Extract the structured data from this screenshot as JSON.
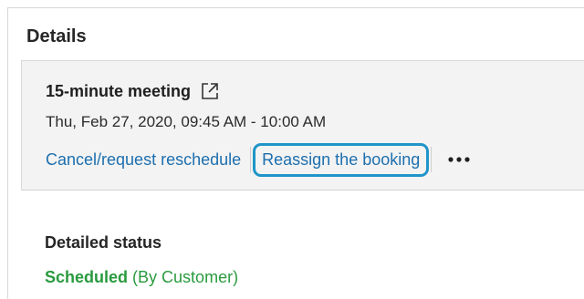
{
  "panel": {
    "title": "Details"
  },
  "booking": {
    "title": "15-minute meeting",
    "time": "Thu, Feb 27, 2020, 09:45 AM - 10:00 AM",
    "actions": {
      "cancel_label": "Cancel/request reschedule",
      "reassign_label": "Reassign the booking",
      "more_icon": "more-horizontal-icon"
    },
    "title_icon": "external-link-icon"
  },
  "status": {
    "label": "Detailed status",
    "value": "Scheduled",
    "by": "(By Customer)"
  },
  "colors": {
    "link": "#1d6fae",
    "focus_ring": "#1f95c9",
    "status_green": "#2a9a3f"
  }
}
